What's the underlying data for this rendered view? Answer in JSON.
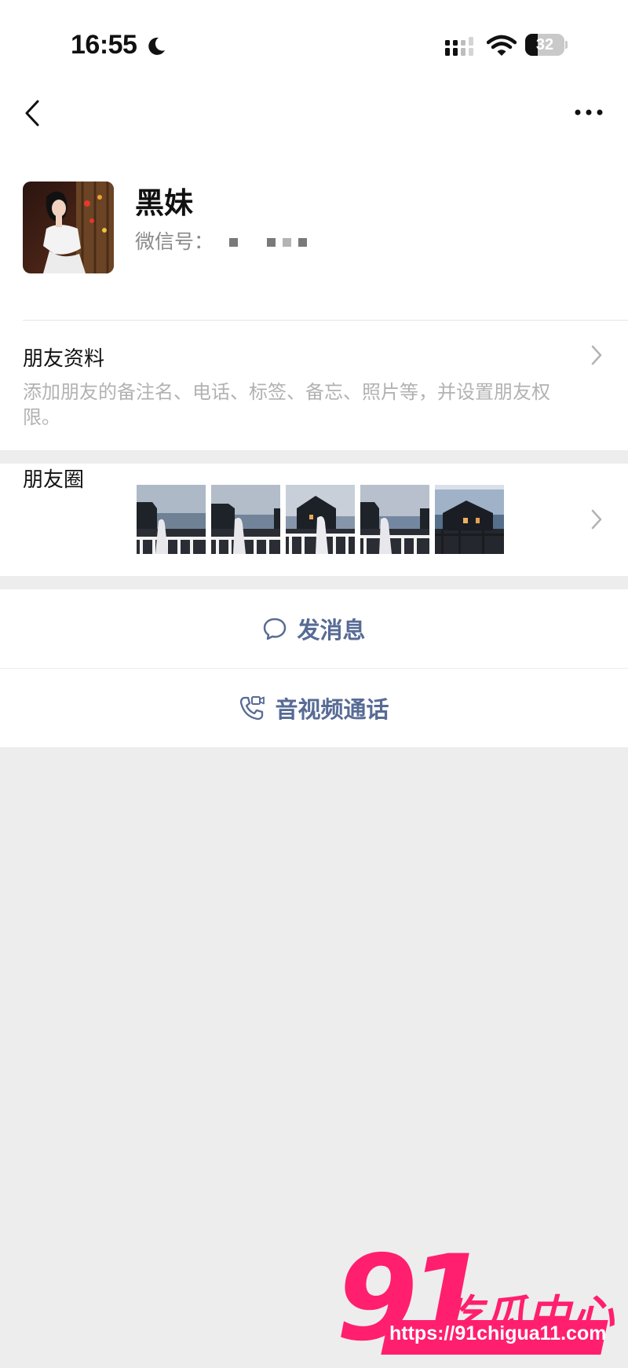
{
  "status_bar": {
    "time": "16:55",
    "battery": "32",
    "battery_level": 0.32
  },
  "profile": {
    "name": "黑妹",
    "wechat_id_label": "微信号："
  },
  "friend_info": {
    "title": "朋友资料",
    "description": "添加朋友的备注名、电话、标签、备忘、照片等，并设置朋友权限。"
  },
  "moments": {
    "label": "朋友圈",
    "photo_count": 5
  },
  "actions": {
    "message_label": "发消息",
    "call_label": "音视频通话"
  },
  "watermark": {
    "number": "91",
    "brand": "吃瓜中心",
    "url": "https://91chigua11.com"
  },
  "colors": {
    "link_blue": "#576b95",
    "page_bg": "#ededed",
    "watermark_pink": "#ff1f6e"
  }
}
